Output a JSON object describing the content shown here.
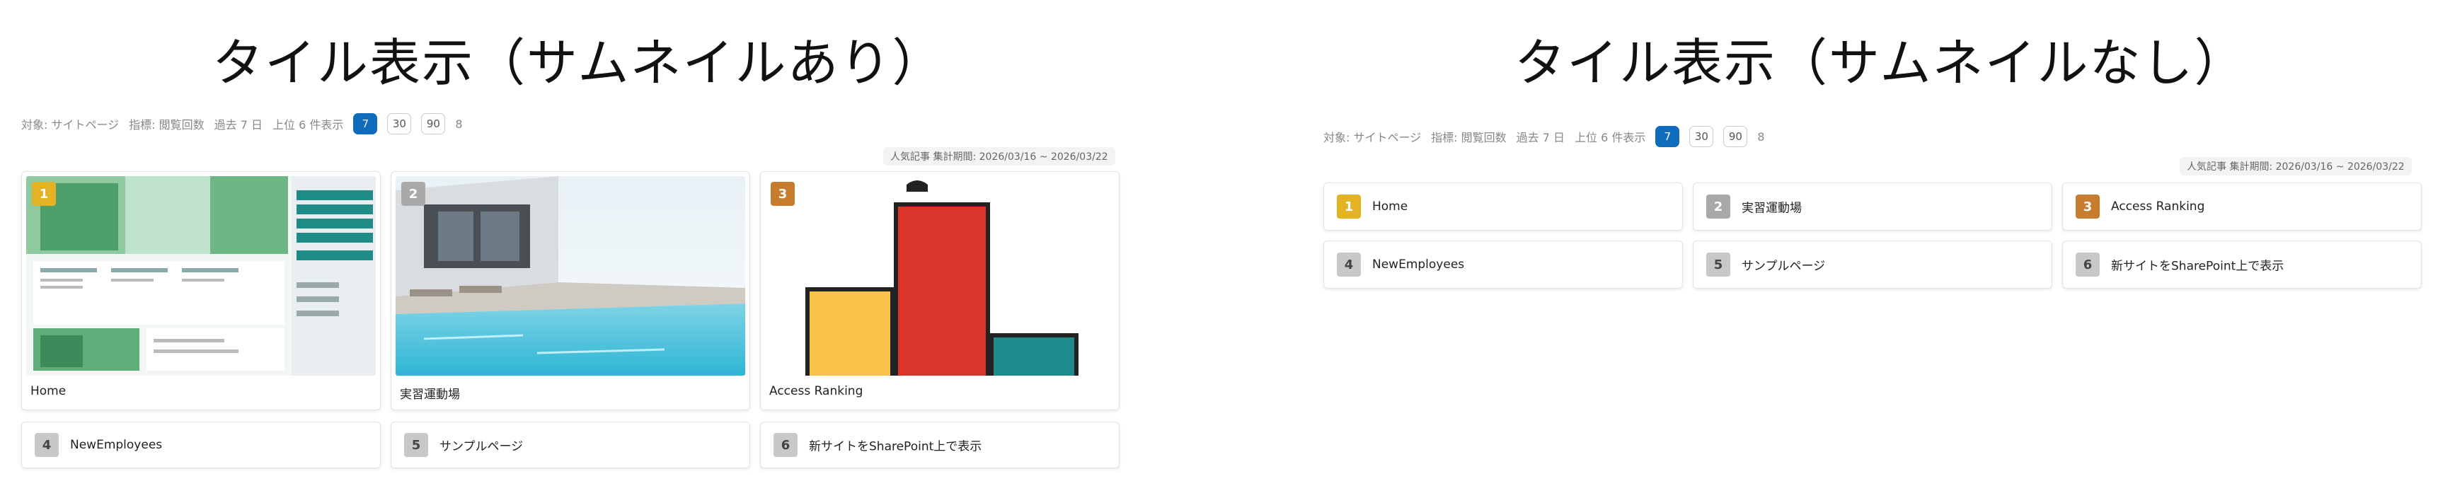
{
  "left": {
    "title": "タイル表示（サムネイルあり）",
    "controls": {
      "target": "対象: サイトページ",
      "sort": "指標: 閲覧回数",
      "range": "過去 7 日",
      "limit": "上位 6 件表示",
      "counts": [
        "7",
        "30",
        "90",
        "8"
      ]
    },
    "period": "人気記事 集計期間: 2026/03/16 ~ 2026/03/22",
    "tiles": [
      {
        "rank": "1",
        "label": "Home"
      },
      {
        "rank": "2",
        "label": "実習運動場"
      },
      {
        "rank": "3",
        "label": "Access Ranking"
      }
    ],
    "rows": [
      {
        "rank": "4",
        "label": "NewEmployees"
      },
      {
        "rank": "5",
        "label": "サンプルページ"
      },
      {
        "rank": "6",
        "label": "新サイトをSharePoint上で表示"
      }
    ]
  },
  "right": {
    "title": "タイル表示（サムネイルなし）",
    "controls": {
      "target": "対象: サイトページ",
      "sort": "指標: 閲覧回数",
      "range": "過去 7 日",
      "limit": "上位 6 件表示",
      "counts": [
        "7",
        "30",
        "90",
        "8"
      ]
    },
    "period": "人気記事 集計期間: 2026/03/16 ~ 2026/03/22",
    "items": [
      {
        "rank": "1",
        "label": "Home"
      },
      {
        "rank": "2",
        "label": "実習運動場"
      },
      {
        "rank": "3",
        "label": "Access Ranking"
      },
      {
        "rank": "4",
        "label": "NewEmployees"
      },
      {
        "rank": "5",
        "label": "サンプルページ"
      },
      {
        "rank": "6",
        "label": "新サイトをSharePoint上で表示"
      }
    ]
  },
  "colors": {
    "accent": "#0f6cbd",
    "gold": "#e3b323",
    "silver": "#a9a9a9",
    "bronze": "#c77c2e"
  }
}
